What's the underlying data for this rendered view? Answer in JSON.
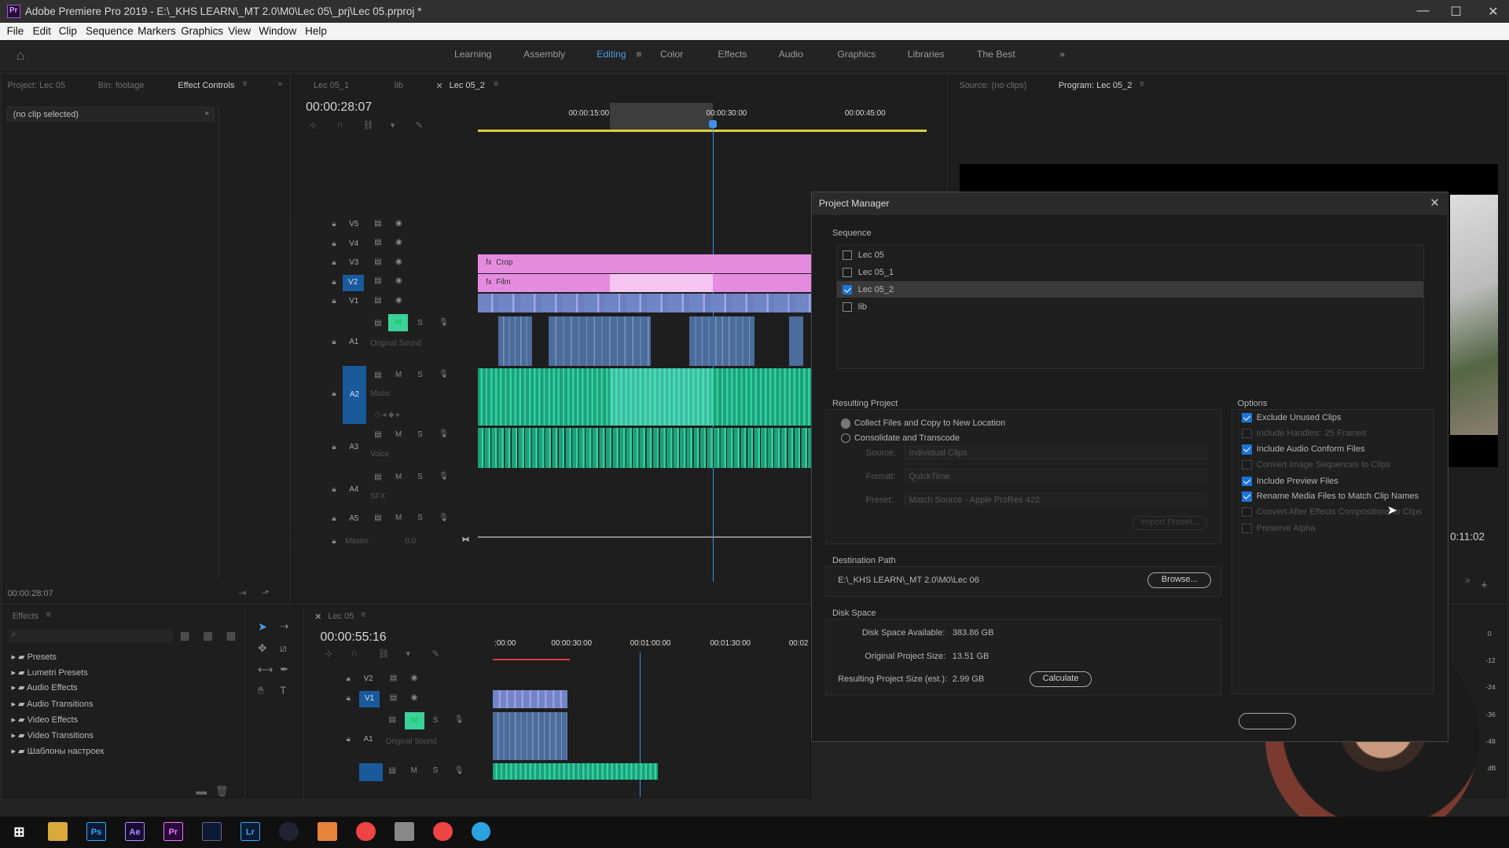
{
  "window": {
    "title": "Adobe Premiere Pro 2019 - E:\\_KHS LEARN\\_MT 2.0\\M0\\Lec 05\\_prj\\Lec 05.prproj *"
  },
  "menu": [
    "File",
    "Edit",
    "Clip",
    "Sequence",
    "Markers",
    "Graphics",
    "View",
    "Window",
    "Help"
  ],
  "workspaces": [
    "Learning",
    "Assembly",
    "Editing",
    "Color",
    "Effects",
    "Audio",
    "Graphics",
    "Libraries",
    "The Best"
  ],
  "left_panel": {
    "tabs": [
      "Project: Lec 05",
      "Bin: footage",
      "Effect Controls"
    ],
    "clip_label": "(no clip selected)",
    "timecode": "00:00:28:07"
  },
  "timeline": {
    "tabs": [
      "Lec 05_1",
      "lib",
      "Lec 05_2"
    ],
    "timecode": "00:00:28:07",
    "ruler": [
      "00:00:15:00",
      "00:00:30:00",
      "00:00:45:00"
    ],
    "video_tracks": [
      "V5",
      "V4",
      "V3",
      "V2",
      "V1"
    ],
    "audio_tracks": [
      "A1",
      "A2",
      "A3",
      "A4",
      "A5"
    ],
    "audio_names": [
      "Original Sound",
      "Music",
      "Voice",
      "SFX"
    ],
    "master": "Master",
    "master_val": "0.0",
    "clips": {
      "crop": "Crop",
      "film": "Film"
    }
  },
  "monitor": {
    "source": "Source: (no clips)",
    "program": "Program: Lec 05_2",
    "time": "0:11:02"
  },
  "effects_panel": {
    "title": "Effects",
    "items": [
      "Presets",
      "Lumetri Presets",
      "Audio Effects",
      "Audio Transitions",
      "Video Effects",
      "Video Transitions",
      "Шаблоны настроек"
    ]
  },
  "timeline2": {
    "tab": "Lec 05",
    "timecode": "00:00:55:16",
    "ruler": [
      ":00:00",
      "00:00:30:00",
      "00:01:00:00",
      "00:01:30:00",
      "00:02"
    ],
    "tracks": [
      "V2",
      "V1",
      "A1"
    ],
    "audio_name": "Original Sound"
  },
  "meter": [
    "0",
    "-12",
    "-24",
    "-36",
    "-48",
    "dB"
  ],
  "dialog": {
    "title": "Project Manager",
    "sequence_label": "Sequence",
    "sequences": [
      {
        "name": "Lec 05",
        "checked": false
      },
      {
        "name": "Lec 05_1",
        "checked": false
      },
      {
        "name": "Lec 05_2",
        "checked": true
      },
      {
        "name": "lib",
        "checked": false
      }
    ],
    "resulting_label": "Resulting Project",
    "opt_collect": "Collect Files and Copy to New Location",
    "opt_consolidate": "Consolidate and Transcode",
    "source_label": "Source:",
    "source_val": "Individual Clips",
    "format_label": "Format:",
    "format_val": "QuickTime",
    "preset_label": "Preset:",
    "preset_val": "Match Source - Apple ProRes 422",
    "import_preset": "Import Preset...",
    "options_label": "Options",
    "options": [
      {
        "label": "Exclude Unused Clips",
        "checked": true,
        "enabled": true
      },
      {
        "label": "Include Handles:",
        "checked": false,
        "enabled": false,
        "extra": "25 Frames"
      },
      {
        "label": "Include Audio Conform Files",
        "checked": true,
        "enabled": true
      },
      {
        "label": "Convert Image Sequences to Clips",
        "checked": false,
        "enabled": false
      },
      {
        "label": "Include Preview Files",
        "checked": true,
        "enabled": true
      },
      {
        "label": "Rename Media Files to Match Clip Names",
        "checked": true,
        "enabled": true
      },
      {
        "label": "Convert After Effects Compositions to Clips",
        "checked": false,
        "enabled": false
      },
      {
        "label": "Preserve Alpha",
        "checked": false,
        "enabled": false
      }
    ],
    "dest_label": "Destination Path",
    "dest_path": "E:\\_KHS LEARN\\_MT 2.0\\M0\\Lec 06",
    "browse": "Browse...",
    "disk_label": "Disk Space",
    "avail_label": "Disk Space Available:",
    "avail_val": "383.86 GB",
    "orig_label": "Original Project Size:",
    "orig_val": "13.51 GB",
    "result_label": "Resulting Project Size (est.):",
    "result_val": "2.99 GB",
    "calculate": "Calculate"
  },
  "taskbar": [
    "Ps",
    "Ae",
    "Pr",
    "Lr"
  ]
}
